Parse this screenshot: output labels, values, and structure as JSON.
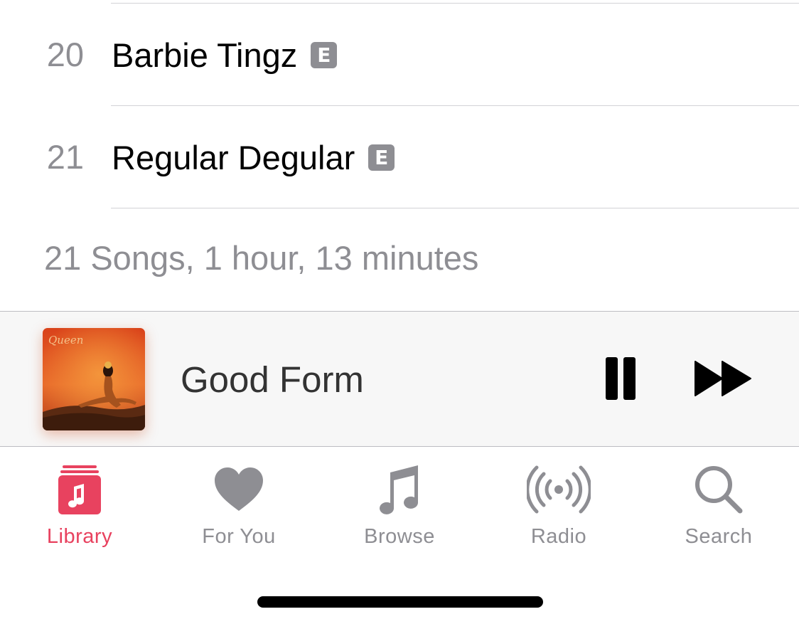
{
  "tracks": [
    {
      "number": "20",
      "title": "Barbie Tingz",
      "explicit": "E"
    },
    {
      "number": "21",
      "title": "Regular Degular",
      "explicit": "E"
    }
  ],
  "album_summary": "21 Songs, 1 hour, 13 minutes",
  "now_playing": {
    "title": "Good Form",
    "artwork_icon": "album-artwork",
    "controls": {
      "pause_icon": "pause-icon",
      "skip_icon": "fast-forward-icon"
    }
  },
  "tab_bar": {
    "tabs": [
      {
        "label": "Library",
        "icon": "library-icon",
        "active": true
      },
      {
        "label": "For You",
        "icon": "heart-icon",
        "active": false
      },
      {
        "label": "Browse",
        "icon": "music-note-icon",
        "active": false
      },
      {
        "label": "Radio",
        "icon": "radio-broadcast-icon",
        "active": false
      },
      {
        "label": "Search",
        "icon": "search-icon",
        "active": false
      }
    ]
  },
  "colors": {
    "accent": "#e8425f",
    "inactive": "#8e8e93",
    "text": "#000000",
    "badge": "#8e8e93"
  }
}
